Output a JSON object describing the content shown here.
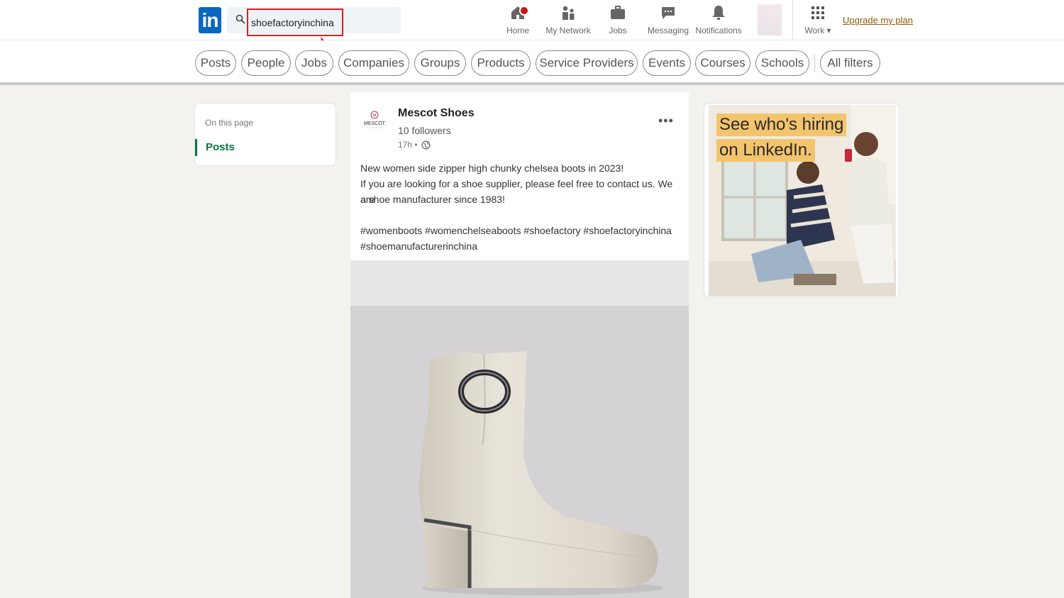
{
  "search": {
    "query": "shoefactoryinchina"
  },
  "nav": {
    "logo": "in",
    "items": [
      {
        "label": "Home",
        "icon": "home-icon"
      },
      {
        "label": "My Network",
        "icon": "network-icon"
      },
      {
        "label": "Jobs",
        "icon": "briefcase-icon"
      },
      {
        "label": "Messaging",
        "icon": "chat-icon"
      },
      {
        "label": "Notifications",
        "icon": "bell-icon"
      }
    ],
    "work_label": "Work",
    "upgrade": "Upgrade my plan"
  },
  "filters": [
    "Posts",
    "People",
    "Jobs",
    "Companies",
    "Groups",
    "Products",
    "Service Providers",
    "Events",
    "Courses",
    "Schools",
    "All filters"
  ],
  "sidebar": {
    "heading": "On this page",
    "link": "Posts"
  },
  "post": {
    "company_logo_text": "MESCOT",
    "company": "Mescot Shoes",
    "followers": "10 followers",
    "time": "17h •",
    "line1": "New women side zipper high chunky chelsea boots in 2023!",
    "line2": "If you are looking for a shoe supplier, please feel free to contact us. We are",
    "line3": "a shoe manufacturer since 1983!",
    "tags1": "#womenboots #womenchelseaboots #shoefactory #shoefactoryinchina",
    "tags2": "#shoemanufacturerinchina"
  },
  "ad": {
    "line1": "See who's hiring",
    "line2": "on LinkedIn."
  },
  "colors": {
    "brand": "#0a66c2",
    "green": "#057642",
    "highlight": "#e02020",
    "ad_label": "#f4c46d"
  }
}
